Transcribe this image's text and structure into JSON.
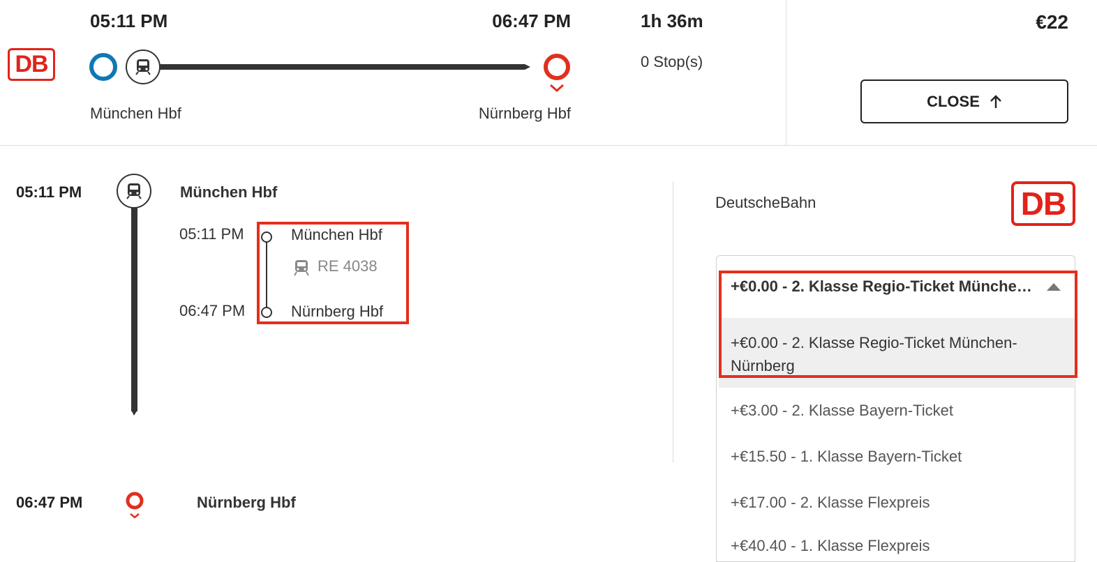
{
  "header": {
    "departure_time": "05:11 PM",
    "arrival_time": "06:47 PM",
    "duration": "1h 36m",
    "stops": "0 Stop(s)",
    "price": "€22",
    "origin": "München Hbf",
    "destination": "Nürnberg Hbf",
    "close_label": "CLOSE",
    "operator_logo_text": "DB"
  },
  "itinerary": {
    "start_time": "05:11 PM",
    "start_station": "München Hbf",
    "end_time": "06:47 PM",
    "end_station": "Nürnberg Hbf",
    "leg": {
      "depart_time": "05:11 PM",
      "depart_station": "München Hbf",
      "train": "RE 4038",
      "arrive_time": "06:47 PM",
      "arrive_station": "Nürnberg Hbf"
    }
  },
  "operator": {
    "name": "DeutscheBahn",
    "logo_text": "DB"
  },
  "fare_select": {
    "selected": "+€0.00 - 2. Klasse Regio-Ticket München-Nürnberg",
    "options": [
      "+€0.00 - 2. Klasse Regio-Ticket München-Nürnberg",
      "+€3.00 - 2. Klasse Bayern-Ticket",
      "+€15.50 - 1. Klasse Bayern-Ticket",
      "+€17.00 - 2. Klasse Flexpreis",
      "+€40.40 - 1. Klasse Flexpreis"
    ]
  },
  "colors": {
    "db_red": "#e2231a",
    "origin_blue": "#0f78b4",
    "destination_red": "#e0301e",
    "highlight_red": "#e52e1c",
    "route_line": "#333333"
  }
}
